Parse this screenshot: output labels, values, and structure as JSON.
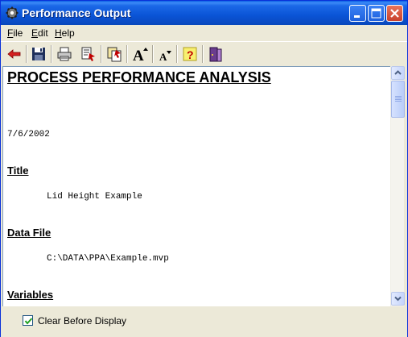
{
  "window": {
    "title": "Performance Output",
    "icon": "gear-icon"
  },
  "titlebar_buttons": [
    "minimize-icon",
    "maximize-icon",
    "close-icon"
  ],
  "menu": {
    "file": {
      "accel": "F",
      "rest": "ile"
    },
    "edit": {
      "accel": "E",
      "rest": "dit"
    },
    "help": {
      "accel": "H",
      "rest": "elp"
    }
  },
  "toolbar": {
    "icons": [
      "back-arrow-icon",
      "save-icon",
      "print-icon",
      "print-preview-icon",
      "copy-icon",
      "increase-font-icon",
      "decrease-font-icon",
      "help-icon",
      "exit-icon"
    ],
    "increase_font_glyph": "A",
    "decrease_font_glyph": "A",
    "help_glyph": "?"
  },
  "document": {
    "title": "PROCESS PERFORMANCE ANALYSIS",
    "date": "7/6/2002",
    "sections": {
      "title_heading": "Title",
      "title_value": "Lid Height Example",
      "datafile_heading": "Data File",
      "datafile_value": "C:\\DATA\\PPA\\Example.mvp",
      "variables_heading": "Variables"
    }
  },
  "bottom": {
    "clear_checkbox_label": "Clear Before Display",
    "clear_checkbox_checked": true
  },
  "colors": {
    "titlebar": "#0A54D6",
    "close_button": "#C8412C",
    "window_bg": "#ECE9D8"
  }
}
